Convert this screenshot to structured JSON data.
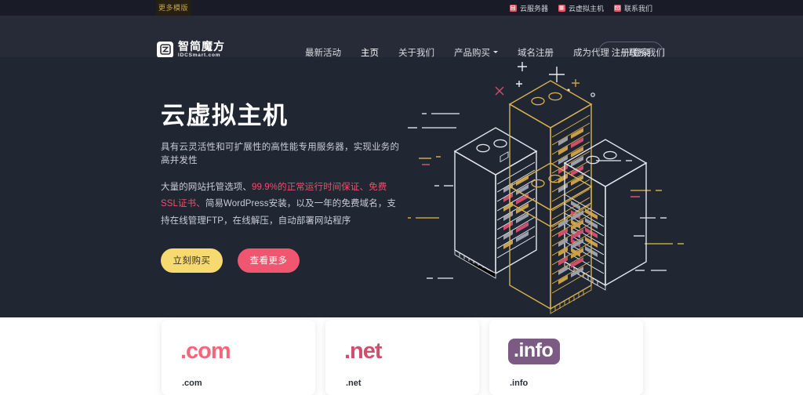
{
  "topbar": {
    "more_templates": "更多模版",
    "links": [
      {
        "label": "云服务器",
        "icon": "server-icon"
      },
      {
        "label": "云虚拟主机",
        "icon": "stack-icon"
      },
      {
        "label": "联系我们",
        "icon": "mail-icon"
      }
    ]
  },
  "header": {
    "logo": {
      "cn": "智简魔方",
      "en": "IDCSmart.com",
      "icon": "logo-mark-icon"
    },
    "nav": [
      {
        "label": "最新活动",
        "active": false,
        "dropdown": false
      },
      {
        "label": "主页",
        "active": true,
        "dropdown": false
      },
      {
        "label": "关于我们",
        "active": false,
        "dropdown": false
      },
      {
        "label": "产品购买",
        "active": false,
        "dropdown": true
      },
      {
        "label": "域名注册",
        "active": false,
        "dropdown": false
      },
      {
        "label": "成为代理",
        "active": false,
        "dropdown": false
      },
      {
        "label": "联系我们",
        "active": false,
        "dropdown": false
      }
    ],
    "login_label": "注册/登录"
  },
  "hero": {
    "title": "云虚拟主机",
    "subtitle": "具有云灵活性和可扩展性的高性能专用服务器，实现业务的高并发性",
    "desc_part1": "大量的网站托管选项、",
    "desc_highlight": "99.9%的正常运行时间保证、免费SSL证书、",
    "desc_part2": "简易WordPress安装，以及一年的免费域名，支持在线管理FTP，在线解压，自动部署网站程序",
    "buy_label": "立刻购买",
    "more_label": "查看更多",
    "illustration": "isometric-server-racks",
    "dots": [
      {
        "active": true
      },
      {
        "active": false
      },
      {
        "active": false
      }
    ]
  },
  "domain_cards": [
    {
      "logo_text": ".com",
      "name": ".com",
      "style": "com",
      "color": "#f4667a"
    },
    {
      "logo_text": ".net",
      "name": ".net",
      "style": "net",
      "color": "#cf4e6d"
    },
    {
      "logo_text": ".info",
      "name": ".info",
      "style": "info",
      "color": "#7b5b83"
    }
  ],
  "colors": {
    "topbar_bg": "#191c26",
    "header_bg": "#272b37",
    "hero_bg": "#212633",
    "accent_pink": "#f0566f",
    "accent_yellow": "#f6d96f",
    "accent_gold": "#c8a04a"
  }
}
